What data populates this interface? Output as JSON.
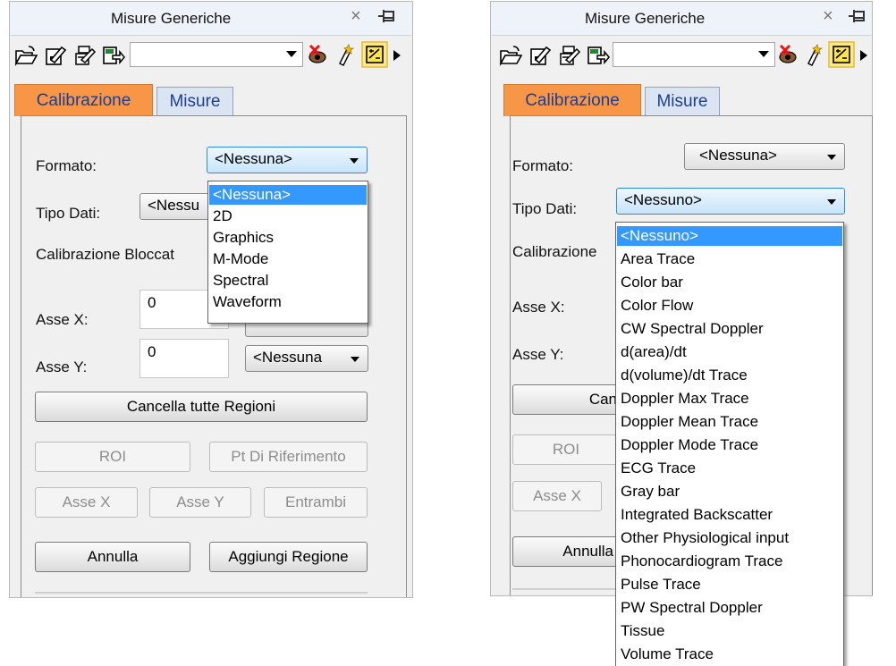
{
  "left": {
    "title": "Misure Generiche",
    "close_glyph": "×",
    "toolbar": {
      "combo_value": "",
      "icons": [
        "open-folder-icon",
        "edit-icon",
        "batch-edit-icon",
        "export-icon",
        "eye-error-icon",
        "magic-icon",
        "calibrate-icon",
        "play-triangle-icon"
      ]
    },
    "tabs": [
      {
        "label": "Calibrazione",
        "active": true
      },
      {
        "label": "Misure",
        "active": false
      }
    ],
    "formato_label": "Formato:",
    "formato_value": "<Nessuna>",
    "tipo_dati_label": "Tipo Dati:",
    "tipo_dati_value": "<Nessu",
    "calibrazione_label": "Calibrazione Bloccat",
    "asse_x_label": "Asse X:",
    "asse_x_value": "0",
    "asse_y_label": "Asse Y:",
    "asse_y_value": "0",
    "asse_y_unit": "<Nessuna",
    "cancella_btn": "Cancella tutte Regioni",
    "roi_btn": "ROI",
    "pt_btn": "Pt Di Riferimento",
    "assex_btn": "Asse X",
    "assey_btn": "Asse Y",
    "entrambi_btn": "Entrambi",
    "annulla_btn": "Annulla",
    "aggiungi_btn": "Aggiungi Regione",
    "formato_options": [
      "<Nessuna>",
      "2D",
      "Graphics",
      "M-Mode",
      "Spectral",
      "Waveform"
    ],
    "formato_selected": "<Nessuna>"
  },
  "right": {
    "title": "Misure Generiche",
    "close_glyph": "×",
    "tabs": [
      {
        "label": "Calibrazione",
        "active": true
      },
      {
        "label": "Misure",
        "active": false
      }
    ],
    "formato_label": "Formato:",
    "formato_value": "<Nessuna>",
    "tipo_dati_label": "Tipo Dati:",
    "tipo_dati_value": "<Nessuno>",
    "calibrazione_label": "Calibrazione",
    "asse_x_label": "Asse X:",
    "asse_y_label": "Asse Y:",
    "cancella_btn": "Can",
    "roi_btn": "ROI",
    "assex_btn": "Asse X",
    "annulla_btn": "Annulla",
    "tipo_options": [
      "<Nessuno>",
      "Area Trace",
      "Color bar",
      "Color Flow",
      "CW Spectral Doppler",
      "d(area)/dt",
      "d(volume)/dt Trace",
      "Doppler Max Trace",
      "Doppler Mean Trace",
      "Doppler Mode Trace",
      "ECG Trace",
      "Gray bar",
      "Integrated Backscatter",
      "Other Physiological input",
      "Phonocardiogram Trace",
      "Pulse Trace",
      "PW Spectral Doppler",
      "Tissue",
      "Volume Trace"
    ],
    "tipo_selected": "<Nessuno>"
  },
  "colors": {
    "active_tab": "#f79646",
    "tab_text": "#1c3f94",
    "selection": "#3399ff"
  }
}
